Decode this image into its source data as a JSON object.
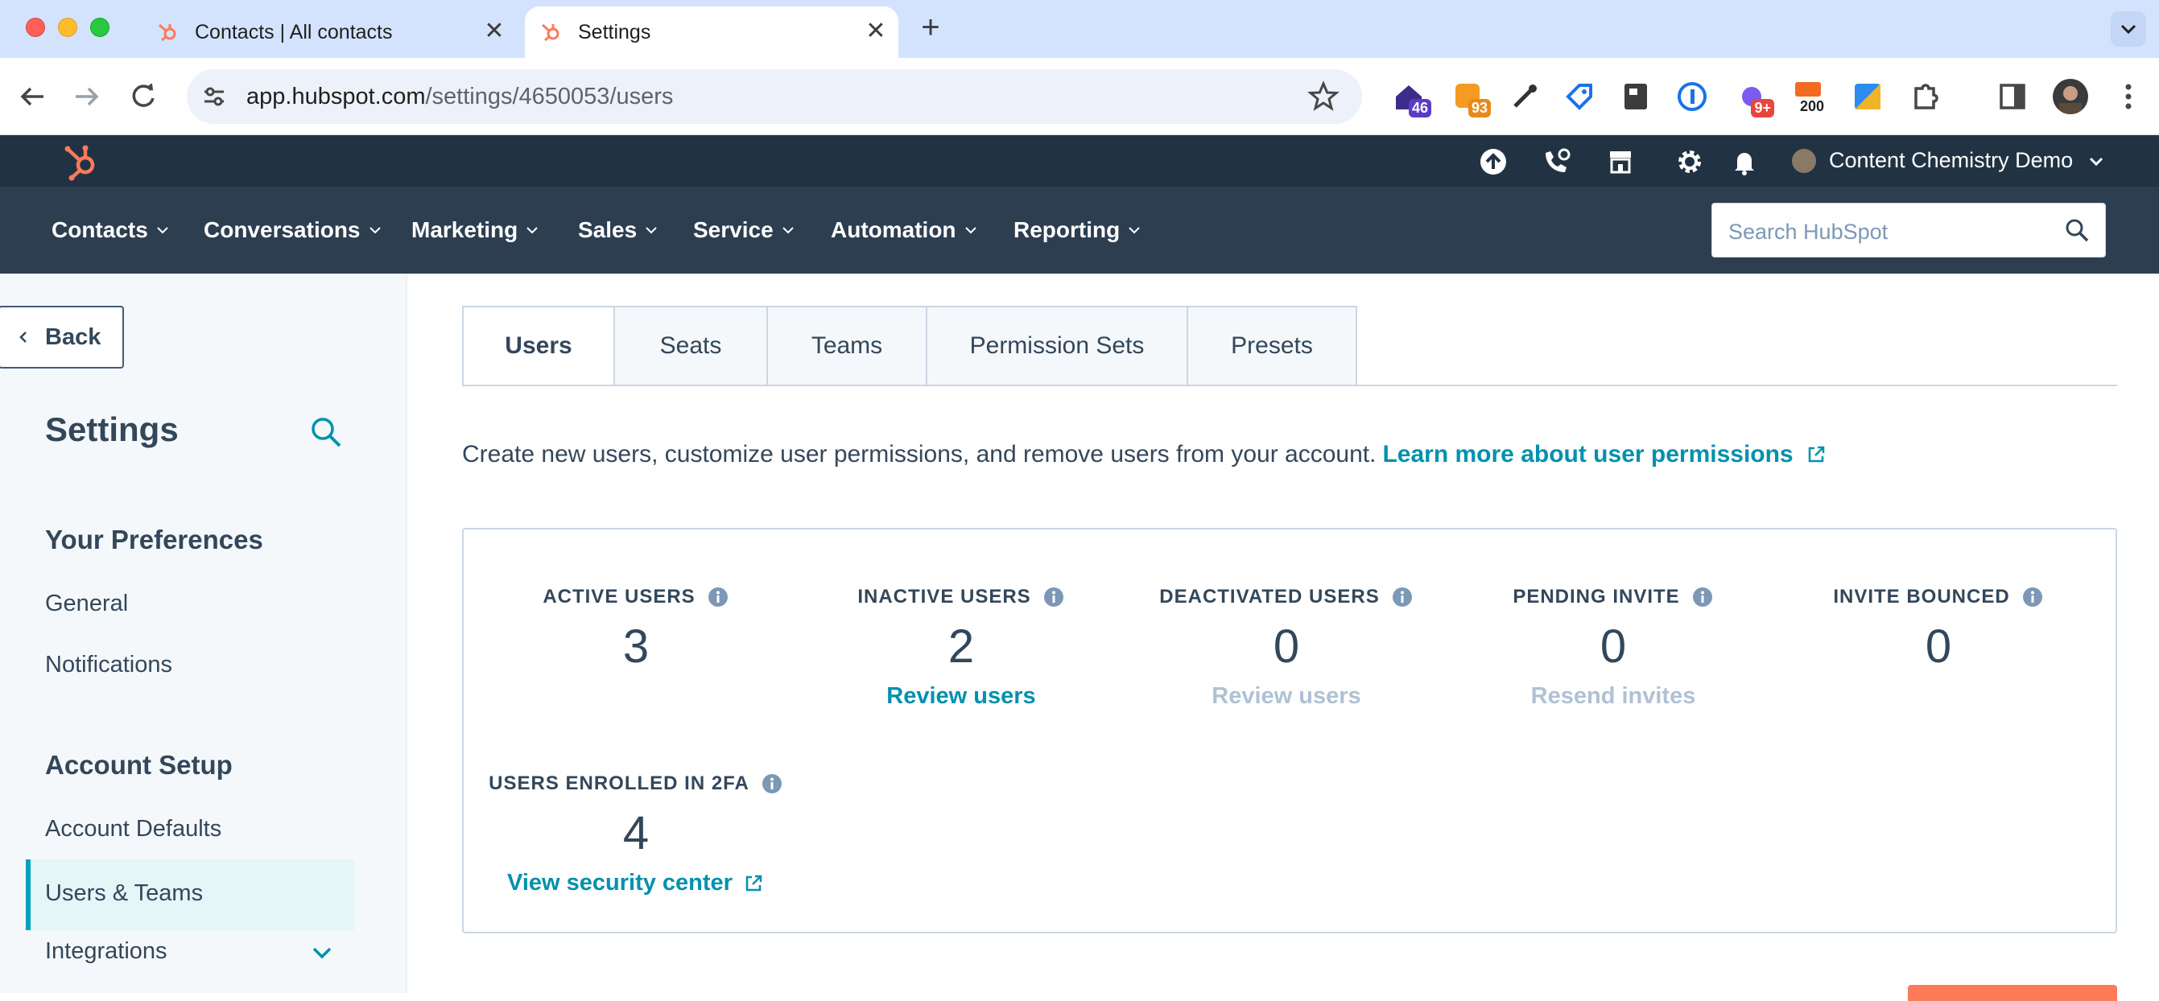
{
  "browser": {
    "tabs": [
      {
        "title": "Contacts | All contacts",
        "active": false
      },
      {
        "title": "Settings",
        "active": true
      }
    ],
    "url_host": "app.hubspot.com",
    "url_path": "/settings/4650053/users",
    "extension_badges": [
      "46",
      "93",
      "9+",
      "200"
    ]
  },
  "topbar": {
    "account_name": "Content Chemistry Demo"
  },
  "nav": {
    "items": [
      "Contacts",
      "Conversations",
      "Marketing",
      "Sales",
      "Service",
      "Automation",
      "Reporting"
    ],
    "search_placeholder": "Search HubSpot"
  },
  "sidebar": {
    "back_label": "Back",
    "title": "Settings",
    "sections": [
      {
        "heading": "Your Preferences",
        "items": [
          "General",
          "Notifications"
        ]
      },
      {
        "heading": "Account Setup",
        "items": [
          "Account Defaults",
          "Users & Teams",
          "Integrations"
        ]
      }
    ],
    "active_item": "Users & Teams"
  },
  "main": {
    "tabs": [
      "Users",
      "Seats",
      "Teams",
      "Permission Sets",
      "Presets"
    ],
    "active_tab": "Users",
    "intro_text": "Create new users, customize user permissions, and remove users from your account.",
    "intro_link": "Learn more about user permissions",
    "stats": [
      {
        "label": "ACTIVE USERS",
        "value": "3",
        "action": ""
      },
      {
        "label": "INACTIVE USERS",
        "value": "2",
        "action": "Review users"
      },
      {
        "label": "DEACTIVATED USERS",
        "value": "0",
        "action": "Review users"
      },
      {
        "label": "PENDING INVITE",
        "value": "0",
        "action": "Resend invites"
      },
      {
        "label": "INVITE BOUNCED",
        "value": "0",
        "action": ""
      }
    ],
    "twofa": {
      "label": "USERS ENROLLED IN 2FA",
      "value": "4",
      "action": "View security center"
    }
  },
  "colors": {
    "utility_bar": "#213343",
    "nav_bar": "#2d3e50",
    "link": "#0091ae",
    "disabled_link": "#b0c1d4",
    "active_indicator": "#00a4bd",
    "brand_orange": "#ff7a59"
  }
}
